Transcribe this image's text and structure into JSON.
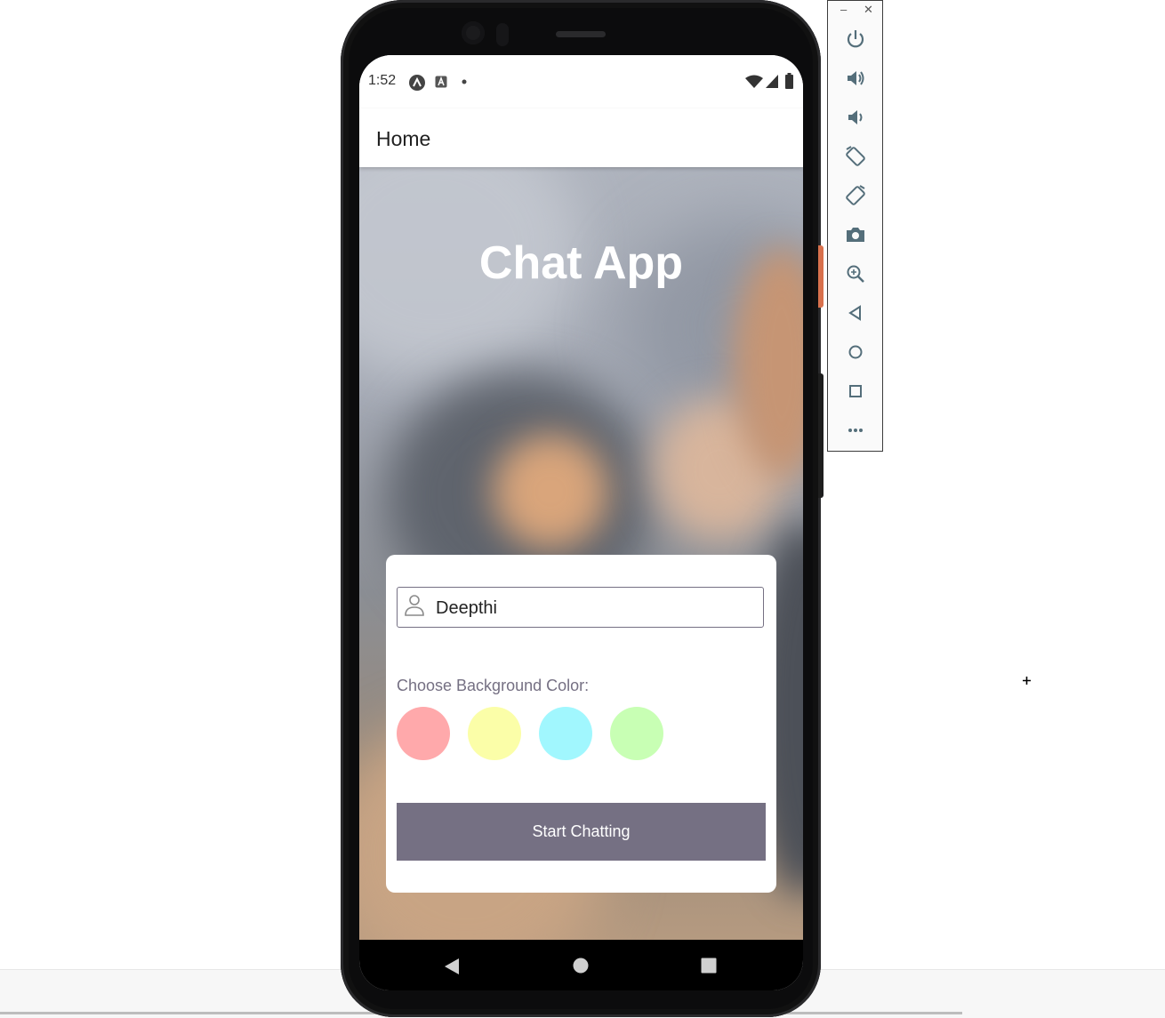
{
  "status_bar": {
    "time": "1:52"
  },
  "app_bar": {
    "title": "Home"
  },
  "main": {
    "app_title": "Chat App",
    "name_input": {
      "value": "Deepthi"
    },
    "color_label": "Choose Background Color:",
    "colors": [
      "#ffa9ab",
      "#fbfea8",
      "#a1f7fe",
      "#c8ffb4"
    ],
    "start_button": "Start Chatting"
  },
  "colors": {
    "accent": "#757083",
    "card": "#ffffff"
  },
  "emulator_toolbar": {
    "window_controls": [
      "–",
      "✕"
    ],
    "icons": [
      "power-icon",
      "volume-up-icon",
      "volume-down-icon",
      "rotate-left-icon",
      "rotate-right-icon",
      "camera-icon",
      "zoom-icon",
      "back-icon",
      "home-icon",
      "overview-icon",
      "more-icon"
    ]
  }
}
